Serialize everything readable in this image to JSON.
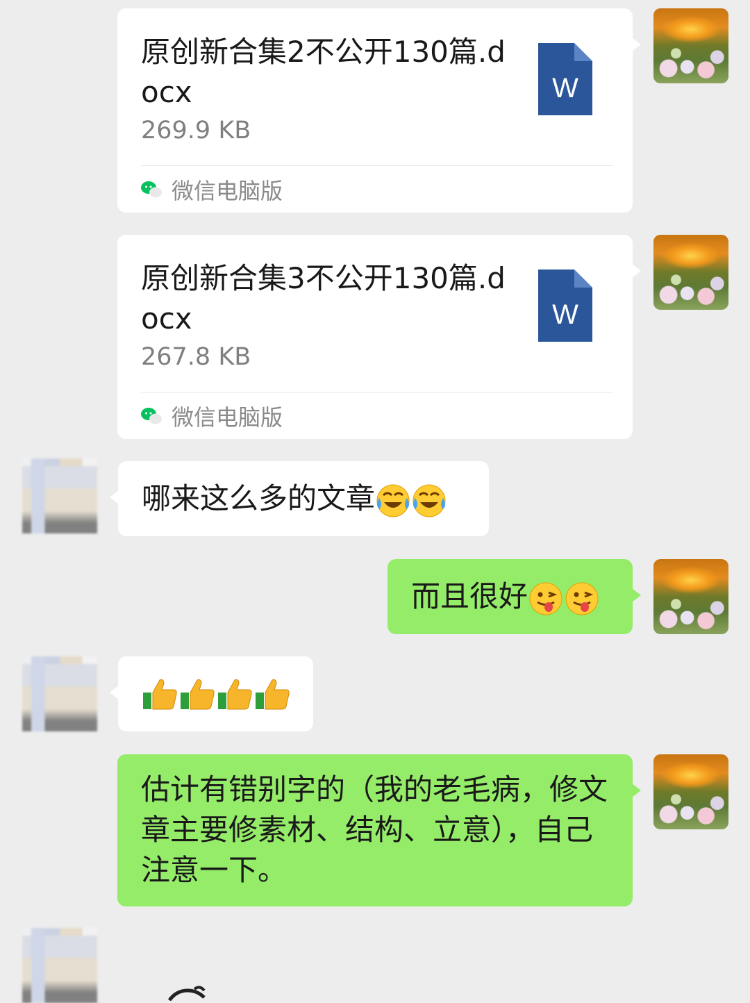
{
  "messages": [
    {
      "id": "m1",
      "side": "right",
      "type": "file",
      "file_name": "原创新合集2不公开130篇.docx",
      "file_size": "269.9 KB",
      "source": "微信电脑版",
      "file_icon": "word-doc-icon",
      "icon_letter": "W"
    },
    {
      "id": "m2",
      "side": "right",
      "type": "file",
      "file_name": "原创新合集3不公开130篇.docx",
      "file_size": "267.8 KB",
      "source": "微信电脑版",
      "file_icon": "word-doc-icon",
      "icon_letter": "W"
    },
    {
      "id": "m3",
      "side": "left",
      "type": "text",
      "text": "哪来这么多的文章",
      "emoji": [
        "face-with-tears-of-joy-icon",
        "face-with-tears-of-joy-icon"
      ]
    },
    {
      "id": "m4",
      "side": "right",
      "type": "text",
      "text": "而且很好",
      "emoji": [
        "winking-face-with-tongue-icon",
        "winking-face-with-tongue-icon"
      ]
    },
    {
      "id": "m5",
      "side": "left",
      "type": "emoji",
      "emoji": [
        "thumbs-up-icon",
        "thumbs-up-icon",
        "thumbs-up-icon",
        "thumbs-up-icon"
      ]
    },
    {
      "id": "m6",
      "side": "right",
      "type": "text",
      "text": "估计有错别字的（我的老毛病，修文章主要修素材、结构、立意），自己注意一下。"
    }
  ],
  "colors": {
    "background": "#ededed",
    "my_bubble": "#95ec69",
    "their_bubble": "#ffffff",
    "word_blue": "#2b579a",
    "wechat_green": "#07c160"
  }
}
